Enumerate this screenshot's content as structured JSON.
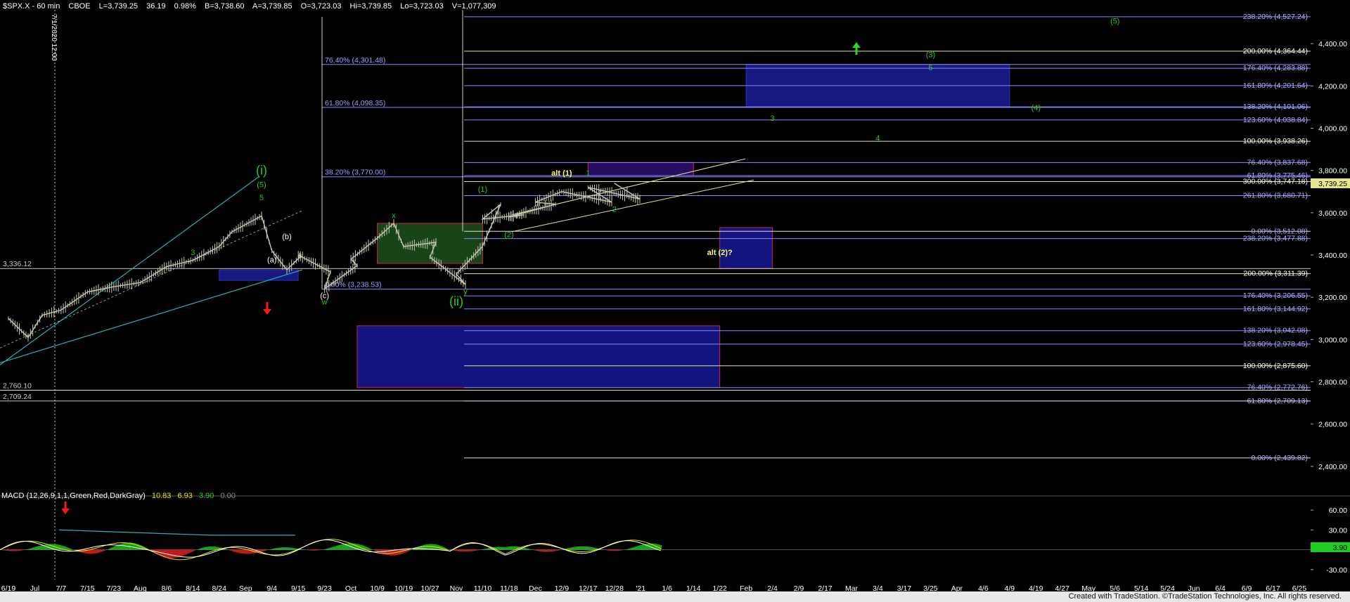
{
  "header": {
    "symbol": "$SPX.X - 60 min",
    "exchange": "CBOE",
    "last": "L=3,739.25",
    "change": "36.19",
    "change_pct": "0.98%",
    "bid": "B=3,738.60",
    "ask": "A=3,739.85",
    "open": "O=3,723.03",
    "high": "Hi=3,739.85",
    "low": "Lo=3,723.03",
    "volume": "V=1,077,309"
  },
  "vertical_date_label": "7/1/2020 12:00",
  "footer": "Created with TradeStation. ©TradeStation Technologies, Inc. All rights reserved.",
  "colors": {
    "background": "#000000",
    "price_bar": "#c8c8b4",
    "green_label": "#22cc22",
    "yellow": "#e6e68c",
    "blue_box": "#1a1a8c",
    "red_box": "#cc2244",
    "green_box": "#1a4a1a",
    "cyan_line": "#2ab0b0",
    "red_arrow": "#ff1a1a",
    "green_arrow": "#22dd22"
  },
  "chart_data": {
    "type": "line",
    "title": "$SPX.X - 60 min",
    "price_axis": {
      "ylim": [
        2280,
        4560
      ],
      "ticks": [
        "4,400.00",
        "4,200.00",
        "4,000.00",
        "3,800.00",
        "3,600.00",
        "3,400.00",
        "3,200.00",
        "3,000.00",
        "2,800.00",
        "2,600.00",
        "2,400.00"
      ],
      "tick_values": [
        4400,
        4200,
        4000,
        3800,
        3600,
        3400,
        3200,
        3000,
        2800,
        2600,
        2400
      ],
      "last_price_label": "3,739.25"
    },
    "x_axis": {
      "ticks": [
        "6/19",
        "Jul",
        "7/7",
        "7/15",
        "7/23",
        "Aug",
        "8/6",
        "8/14",
        "8/24",
        "Sep",
        "9/4",
        "9/15",
        "9/23",
        "Oct",
        "10/9",
        "10/19",
        "10/27",
        "Nov",
        "11/10",
        "11/18",
        "Dec",
        "12/9",
        "12/17",
        "12/28",
        "'21",
        "1/6",
        "1/14",
        "1/22",
        "Feb",
        "2/4",
        "2/9",
        "2/17",
        "Mar",
        "3/4",
        "3/17",
        "3/25",
        "Apr",
        "4/6",
        "4/9",
        "4/19",
        "4/27",
        "May",
        "5/6",
        "5/14",
        "5/24",
        "Jun",
        "6/4",
        "6/9",
        "6/17",
        "6/25"
      ]
    },
    "price_series": {
      "name": "",
      "points": [
        {
          "x": "6/19",
          "y": 3100
        },
        {
          "x": "6/26",
          "y": 3010
        },
        {
          "x": "7/1",
          "y": 3115
        },
        {
          "x": "7/7",
          "y": 3140
        },
        {
          "x": "7/15",
          "y": 3225
        },
        {
          "x": "7/23",
          "y": 3250
        },
        {
          "x": "7/31",
          "y": 3270
        },
        {
          "x": "8/6",
          "y": 3345
        },
        {
          "x": "8/14",
          "y": 3375
        },
        {
          "x": "8/24",
          "y": 3440
        },
        {
          "x": "8/31",
          "y": 3510
        },
        {
          "x": "9/2",
          "y": 3585
        },
        {
          "x": "9/4",
          "y": 3420
        },
        {
          "x": "9/8",
          "y": 3330
        },
        {
          "x": "9/11",
          "y": 3395
        },
        {
          "x": "9/15",
          "y": 3400
        },
        {
          "x": "9/18",
          "y": 3320
        },
        {
          "x": "9/23",
          "y": 3240
        },
        {
          "x": "9/28",
          "y": 3350
        },
        {
          "x": "Oct",
          "y": 3380
        },
        {
          "x": "10/9",
          "y": 3480
        },
        {
          "x": "10/12",
          "y": 3550
        },
        {
          "x": "10/19",
          "y": 3440
        },
        {
          "x": "10/23",
          "y": 3460
        },
        {
          "x": "10/27",
          "y": 3390
        },
        {
          "x": "10/30",
          "y": 3260
        },
        {
          "x": "Nov",
          "y": 3310
        },
        {
          "x": "11/4",
          "y": 3440
        },
        {
          "x": "11/9",
          "y": 3640
        },
        {
          "x": "11/10",
          "y": 3570
        },
        {
          "x": "11/13",
          "y": 3590
        },
        {
          "x": "11/18",
          "y": 3580
        },
        {
          "x": "11/24",
          "y": 3640
        },
        {
          "x": "Dec",
          "y": 3650
        },
        {
          "x": "12/9",
          "y": 3700
        },
        {
          "x": "12/11",
          "y": 3650
        },
        {
          "x": "12/17",
          "y": 3720
        },
        {
          "x": "12/21",
          "y": 3665
        },
        {
          "x": "12/28",
          "y": 3739
        }
      ]
    },
    "fib_left": [
      {
        "label": "76.40% (4,301.48)",
        "value": 4301.48
      },
      {
        "label": "61.80% (4,098.35)",
        "value": 4098.35
      },
      {
        "label": "38.20% (3,770.00)",
        "value": 3770.0
      },
      {
        "label": "0.00% (3,238.53)",
        "value": 3238.53
      }
    ],
    "fib_right": [
      {
        "label": "238.20% (4,527.24)",
        "value": 4527.24,
        "color": "blue"
      },
      {
        "label": "200.00% (4,364.44)",
        "value": 4364.44,
        "color": "yellow"
      },
      {
        "label": "176.40% (4,283.88)",
        "value": 4283.88,
        "color": "blue"
      },
      {
        "label": "161.80% (4,201.64)",
        "value": 4201.64,
        "color": "blue"
      },
      {
        "label": "138.20% (4,101.06)",
        "value": 4101.06,
        "color": "blue"
      },
      {
        "label": "123.60% (4,038.84)",
        "value": 4038.84,
        "color": "blue"
      },
      {
        "label": "100.00% (3,938.26)",
        "value": 3938.26,
        "color": "yellow"
      },
      {
        "label": "76.40% (3,837.68)",
        "value": 3837.68,
        "color": "blue"
      },
      {
        "label": "61.80% (3,775.46)",
        "value": 3775.46,
        "color": "blue"
      },
      {
        "label": "300.00% (3,747.18)",
        "value": 3747.18,
        "color": "yellow"
      },
      {
        "label": "261.80% (3,680.71)",
        "value": 3680.71,
        "color": "blue"
      },
      {
        "label": "0.00% (3,512.08)",
        "value": 3512.08,
        "color": "white"
      },
      {
        "label": "238.20% (3,477.88)",
        "value": 3477.88,
        "color": "blue"
      },
      {
        "label": "200.00% (3,311.39)",
        "value": 3311.39,
        "color": "yellow"
      },
      {
        "label": "176.40% (3,206.55)",
        "value": 3206.55,
        "color": "blue"
      },
      {
        "label": "161.80% (3,144.92)",
        "value": 3144.92,
        "color": "blue"
      },
      {
        "label": "138.20% (3,042.08)",
        "value": 3042.08,
        "color": "blue"
      },
      {
        "label": "123.60% (2,978.45)",
        "value": 2978.45,
        "color": "blue"
      },
      {
        "label": "100.00% (2,875.60)",
        "value": 2875.6,
        "color": "yellow"
      },
      {
        "label": "76.40% (2,772.76)",
        "value": 2772.76,
        "color": "blue"
      },
      {
        "label": "61.80% (2,709.13)",
        "value": 2709.13,
        "color": "blue"
      },
      {
        "label": "0.00% (2,439.82)",
        "value": 2439.82,
        "color": "white"
      }
    ],
    "horizontal_levels_left": [
      {
        "label": "3,336.12",
        "value": 3336.12
      },
      {
        "label": "2,760.10",
        "value": 2760.1
      },
      {
        "label": "2,709.24",
        "value": 2709.24
      }
    ],
    "wave_labels": [
      {
        "text": "(i)",
        "x": "9/2",
        "y": 3780,
        "color": "green",
        "size": "large"
      },
      {
        "text": "(5)",
        "x": "9/2",
        "y": 3720,
        "color": "green",
        "size": "small"
      },
      {
        "text": "5",
        "x": "9/2",
        "y": 3660,
        "color": "green",
        "size": "small"
      },
      {
        "text": "3",
        "x": "8/14",
        "y": 3400,
        "color": "green",
        "size": "small"
      },
      {
        "text": "(b)",
        "x": "9/8",
        "y": 3475,
        "color": "white",
        "size": "small"
      },
      {
        "text": "(a)",
        "x": "9/4",
        "y": 3365,
        "color": "white",
        "size": "small"
      },
      {
        "text": "(c)",
        "x": "9/23",
        "y": 3195,
        "color": "white",
        "size": "small"
      },
      {
        "text": "w",
        "x": "9/23",
        "y": 3165,
        "color": "green",
        "size": "small"
      },
      {
        "text": "x",
        "x": "10/12",
        "y": 3575,
        "color": "green",
        "size": "small"
      },
      {
        "text": "y",
        "x": "10/30",
        "y": 3215,
        "color": "green",
        "size": "small"
      },
      {
        "text": "(ii)",
        "x": "Nov",
        "y": 3160,
        "color": "green",
        "size": "large"
      },
      {
        "text": "(1)",
        "x": "11/10",
        "y": 3700,
        "color": "green",
        "size": "small"
      },
      {
        "text": "(2)",
        "x": "11/18",
        "y": 3485,
        "color": "green",
        "size": "small"
      },
      {
        "text": "alt (1)",
        "x": "12/9",
        "y": 3775,
        "color": "yellow",
        "size": "small"
      },
      {
        "text": "1",
        "x": "12/17",
        "y": 3775,
        "color": "green",
        "size": "small"
      },
      {
        "text": "2",
        "x": "12/28",
        "y": 3605,
        "color": "green",
        "size": "small"
      },
      {
        "text": "3",
        "x": "2/4",
        "y": 4035,
        "color": "green",
        "size": "small"
      },
      {
        "text": "4",
        "x": "3/4",
        "y": 3940,
        "color": "green",
        "size": "small"
      },
      {
        "text": "(3)",
        "x": "3/25",
        "y": 4335,
        "color": "green",
        "size": "small"
      },
      {
        "text": "5",
        "x": "3/25",
        "y": 4275,
        "color": "green",
        "size": "small"
      },
      {
        "text": "(4)",
        "x": "4/19",
        "y": 4085,
        "color": "green",
        "size": "small"
      },
      {
        "text": "(5)",
        "x": "5/6",
        "y": 4495,
        "color": "green",
        "size": "small"
      },
      {
        "text": "alt (2)?",
        "x": "1/22",
        "y": 3400,
        "color": "yellow",
        "size": "small"
      }
    ],
    "zones": [
      {
        "name": "blue-target-zone",
        "type": "blue",
        "x_start": "Feb",
        "x_end": "4/9",
        "y_low": 4101.06,
        "y_high": 4301.48
      },
      {
        "name": "red-target-zone",
        "type": "red-outline",
        "x_start": "12/17",
        "x_end": "1/14",
        "y_low": 3775.46,
        "y_high": 3837.68
      },
      {
        "name": "alt2-zone",
        "type": "blue-red-outline",
        "x_start": "1/22",
        "x_end": "2/4",
        "y_low": 3336.12,
        "y_high": 3530
      },
      {
        "name": "lower-support-zone",
        "type": "blue-red-outline",
        "x_start": "9/28",
        "x_end": "1/22",
        "y_low": 2772.76,
        "y_high": 3065
      },
      {
        "name": "oct-green-zone",
        "type": "green",
        "x_start": "10/9",
        "x_end": "11/10",
        "y_low": 3360,
        "y_high": 3550
      },
      {
        "name": "sep-blue-zone",
        "type": "blue",
        "x_start": "8/24",
        "x_end": "9/15",
        "y_low": 3280,
        "y_high": 3330
      }
    ],
    "macd": {
      "label": "MACD (12,26,9,1,1,Green,Red,DarkGray)",
      "value_macd": "10.83",
      "value_signal": "6.93",
      "value_hist": "3.90",
      "value_zero": "0.00",
      "current_label": "3.90",
      "ticks": [
        "60.00",
        "30.00",
        "-30.00"
      ],
      "tick_values": [
        60,
        30,
        -30
      ],
      "ylim": [
        -45,
        75
      ]
    },
    "grid": false,
    "legend": "none"
  }
}
